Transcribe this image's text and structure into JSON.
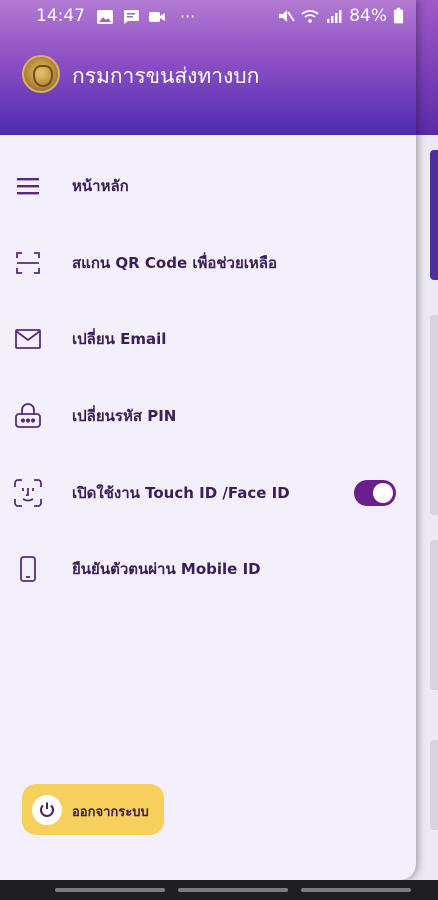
{
  "status_bar": {
    "time": "14:47",
    "dots": "···",
    "battery": "84%",
    "left_icons": [
      "image-icon",
      "message-icon",
      "video-icon"
    ],
    "right_icons": [
      "mute-icon",
      "wifi-icon",
      "signal-icon",
      "battery-icon"
    ]
  },
  "header": {
    "title": "กรมการขนส่งทางบก",
    "logo": "dlt-emblem-logo"
  },
  "menu": {
    "items": [
      {
        "label": "หน้าหลัก",
        "icon": "hamburger-icon"
      },
      {
        "label": "สแกน QR Code เพื่อช่วยเหลือ",
        "icon": "scan-icon"
      },
      {
        "label": "เปลี่ยน Email",
        "icon": "mail-icon"
      },
      {
        "label": "เปลี่ยนรหัส PIN",
        "icon": "pin-lock-icon"
      },
      {
        "label": "เปิดใช้งาน Touch ID /Face ID",
        "icon": "face-id-icon",
        "toggle_on": true
      },
      {
        "label": "ยืนยันตัวตนผ่าน Mobile ID",
        "icon": "mobile-icon"
      }
    ]
  },
  "logout": {
    "label": "ออกจากระบบ",
    "icon": "power-icon"
  },
  "colors": {
    "accent": "#6b1e8f",
    "header_top": "#b37ad2",
    "header_bottom": "#4d2bb0",
    "logout_bg": "#f6cf5c",
    "drawer_bg": "#f3f0fb"
  }
}
